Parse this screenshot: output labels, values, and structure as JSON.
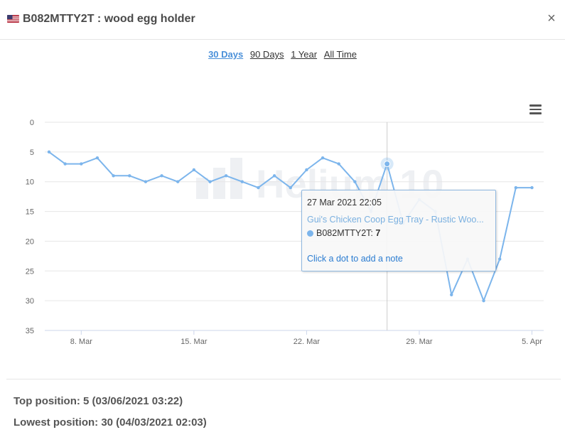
{
  "header": {
    "flag_icon": "us-flag-icon",
    "title": "B082MTTY2T : wood egg holder",
    "close_label": "×"
  },
  "ranges": [
    {
      "label": "30 Days",
      "active": true
    },
    {
      "label": "90 Days",
      "active": false
    },
    {
      "label": "1 Year",
      "active": false
    },
    {
      "label": "All Time",
      "active": false
    }
  ],
  "watermark": "Helium 10",
  "chart_data": {
    "type": "line",
    "y_reversed": true,
    "ylim": [
      0,
      35
    ],
    "y_ticks": [
      "0",
      "5",
      "10",
      "15",
      "20",
      "25",
      "30",
      "35"
    ],
    "x_ticks": [
      "8. Mar",
      "15. Mar",
      "22. Mar",
      "29. Mar",
      "5. Apr"
    ],
    "series": [
      {
        "name": "B082MTTY2T",
        "color": "#7cb5ec",
        "x": [
          "2021-03-06",
          "2021-03-07",
          "2021-03-08",
          "2021-03-09",
          "2021-03-10",
          "2021-03-11",
          "2021-03-12",
          "2021-03-13",
          "2021-03-14",
          "2021-03-15",
          "2021-03-16",
          "2021-03-17",
          "2021-03-18",
          "2021-03-19",
          "2021-03-20",
          "2021-03-21",
          "2021-03-22",
          "2021-03-23",
          "2021-03-24",
          "2021-03-25",
          "2021-03-26",
          "2021-03-27",
          "2021-03-28",
          "2021-03-29",
          "2021-03-30",
          "2021-03-31",
          "2021-04-01",
          "2021-04-02",
          "2021-04-03",
          "2021-04-04",
          "2021-04-05"
        ],
        "values": [
          5,
          7,
          7,
          6,
          9,
          9,
          10,
          9,
          10,
          8,
          10,
          9,
          10,
          11,
          9,
          11,
          8,
          6,
          7,
          10,
          15,
          7,
          17,
          13,
          15,
          29,
          23,
          30,
          23,
          11,
          11
        ]
      }
    ],
    "grid": true,
    "legend": "none"
  },
  "tooltip": {
    "date": "27 Mar 2021 22:05",
    "product": "Gui's Chicken Coop Egg Tray - Rustic Woo...",
    "series_label": "B082MTTY2T:",
    "value": "7",
    "note_link": "Click a dot to add a note"
  },
  "stats": {
    "top": "Top position: 5 (03/06/2021 03:22)",
    "lowest": "Lowest position: 30 (04/03/2021 02:03)"
  }
}
